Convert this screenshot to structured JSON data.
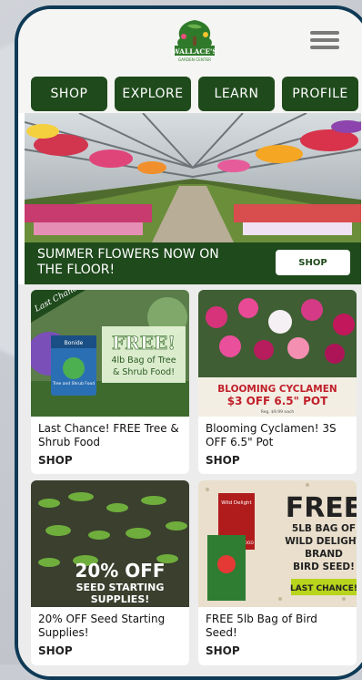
{
  "header": {
    "logo_line1": "WALLACE'S",
    "logo_line2": "GARDEN CENTER",
    "menu_icon": "hamburger-menu-icon"
  },
  "nav": [
    {
      "label": "SHOP"
    },
    {
      "label": "EXPLORE"
    },
    {
      "label": "LEARN"
    },
    {
      "label": "PROFILE"
    }
  ],
  "hero": {
    "banner_text": "SUMMER FLOWERS NOW ON THE FLOOR!",
    "banner_button": "SHOP"
  },
  "cards": [
    {
      "badge": "Last Chance!",
      "promo_big": "FREE!",
      "promo_line1": "4lb Bag of Tree",
      "promo_line2": "& Shrub Food!",
      "bag_brand": "Bonide",
      "bag_label": "Tree and Shrub Food",
      "title": "Last Chance! FREE Tree & Shrub Food",
      "link": "SHOP"
    },
    {
      "promo_line1": "BLOOMING CYCLAMEN",
      "promo_line2": "$3 OFF 6.5\" POT",
      "promo_small": "Reg. $9.99 each",
      "title": "Blooming Cyclamen! 3S OFF 6.5\" Pot",
      "link": "SHOP"
    },
    {
      "promo_line1": "20% OFF",
      "promo_line2": "SEED STARTING",
      "promo_line3": "SUPPLIES!",
      "title": "20% OFF Seed Starting Supplies!",
      "link": "SHOP"
    },
    {
      "promo_big": "FREE",
      "promo_line1": "5LB BAG OF",
      "promo_line2": "WILD DELIGHT",
      "promo_line3": "BRAND",
      "promo_line4": "BIRD SEED!",
      "promo_tag": "LAST CHANCE!",
      "bag_brand": "Wild Delight",
      "bag_label": "CARDINAL FOOD",
      "title": "FREE 5lb Bag of Bird Seed!",
      "link": "SHOP"
    }
  ],
  "colors": {
    "brand_green": "#1f4a1c",
    "phone_frame": "#0f3a56",
    "cyclamen_red": "#c0202a",
    "bird_tag": "#b8d41c"
  }
}
